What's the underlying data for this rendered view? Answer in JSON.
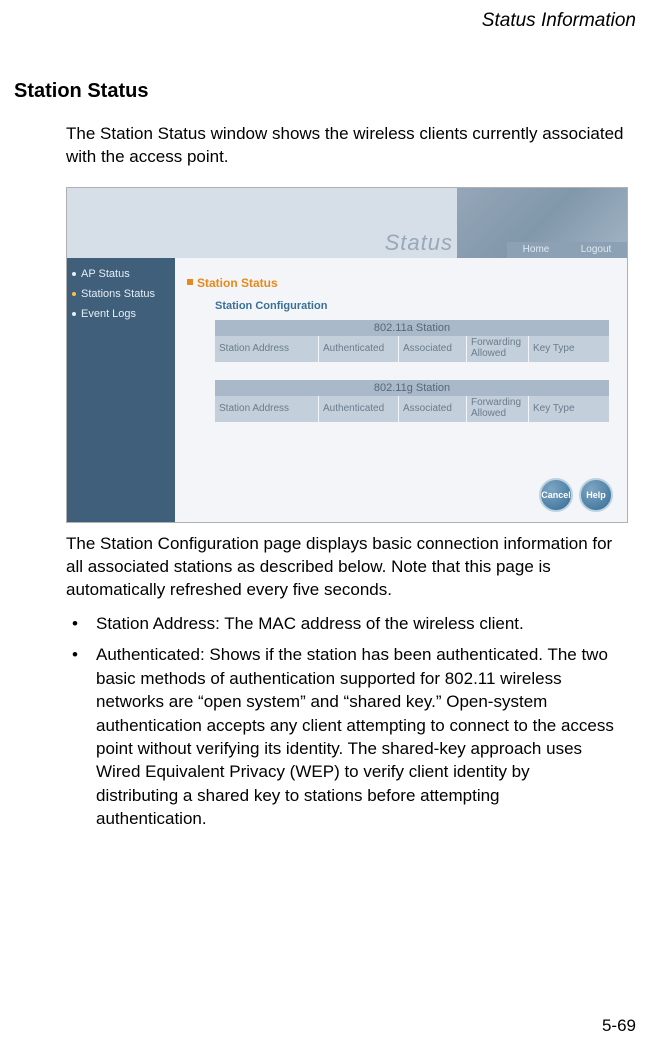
{
  "header": {
    "title": "Status Information"
  },
  "section": {
    "title": "Station Status"
  },
  "intro": "The Station Status window shows the wireless clients currently associated with the access point.",
  "screenshot": {
    "status_word": "Status",
    "homebar": {
      "home": "Home",
      "logout": "Logout"
    },
    "sidebar": {
      "items": [
        {
          "label": "AP Status"
        },
        {
          "label": "Stations Status"
        },
        {
          "label": "Event Logs"
        }
      ]
    },
    "main": {
      "heading": "Station Status",
      "subheading": "Station Configuration",
      "tables": [
        {
          "title": "802.11a Station",
          "cols": [
            "Station Address",
            "Authenticated",
            "Associated",
            "Forwarding Allowed",
            "Key Type"
          ]
        },
        {
          "title": "802.11g Station",
          "cols": [
            "Station Address",
            "Authenticated",
            "Associated",
            "Forwarding Allowed",
            "Key Type"
          ]
        }
      ],
      "buttons": {
        "cancel": "Cancel",
        "help": "Help"
      }
    }
  },
  "after_text": "The Station Configuration page displays basic connection information for all associated stations as described below. Note that this page is automatically refreshed every five seconds.",
  "bullets": [
    "Station Address: The MAC address of the wireless client.",
    "Authenticated: Shows if the station has been authenticated. The two basic methods of authentication supported for 802.11 wireless networks are “open system” and “shared key.” Open-system authentication accepts any client attempting to connect to the access point without verifying its identity. The shared-key approach uses Wired Equivalent Privacy (WEP) to verify client identity by distributing a shared key to stations before attempting authentication."
  ],
  "page_number": "5-69"
}
